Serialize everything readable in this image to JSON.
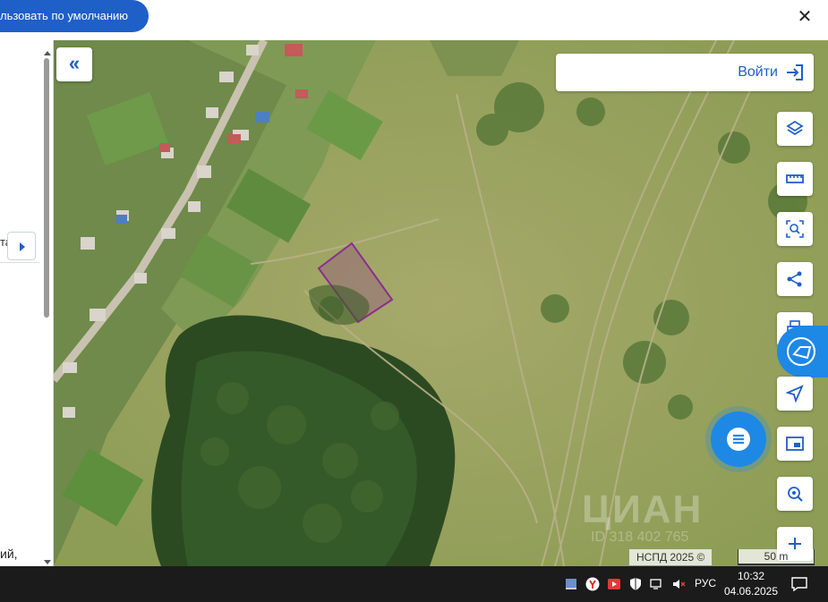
{
  "topbar": {
    "default_button_label": "льзовать по умолчанию",
    "close_label": "✕"
  },
  "left_panel": {
    "text_a": "та т",
    "text_b": "ий,"
  },
  "map": {
    "login_label": "Войти",
    "attribution": "НСПД 2025 ©",
    "scale_label": "50 m",
    "watermark": "ЦИАН",
    "watermark_id": "ID 318 402 765",
    "parcel_color": "#8c2d8f",
    "accent_color": "#1f5fc8",
    "tools": [
      "layers-icon",
      "ruler-icon",
      "search-area-icon",
      "share-icon",
      "print-icon",
      "locate-icon",
      "minimap-icon",
      "geo-search-icon",
      "zoom-in-icon"
    ]
  },
  "taskbar": {
    "lang": "РУС",
    "time": "10:32",
    "date": "04.06.2025"
  }
}
